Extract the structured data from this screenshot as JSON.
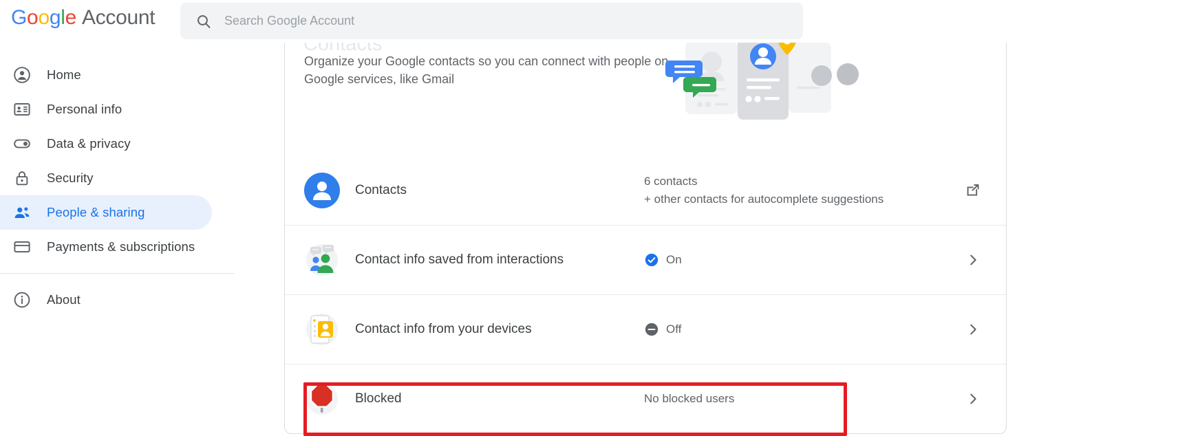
{
  "header": {
    "brand_google": [
      "G",
      "o",
      "o",
      "g",
      "l",
      "e"
    ],
    "brand_account": "Account",
    "search_placeholder": "Search Google Account",
    "search_value": "",
    "search_icon": "search-icon"
  },
  "sidebar": {
    "items": [
      {
        "label": "Home",
        "icon": "account-circle-icon",
        "active": false
      },
      {
        "label": "Personal info",
        "icon": "id-card-icon",
        "active": false
      },
      {
        "label": "Data & privacy",
        "icon": "toggle-switch-icon",
        "active": false
      },
      {
        "label": "Security",
        "icon": "lock-icon",
        "active": false
      },
      {
        "label": "People & sharing",
        "icon": "people-icon",
        "active": true
      },
      {
        "label": "Payments & subscriptions",
        "icon": "credit-card-icon",
        "active": false
      }
    ],
    "about": {
      "label": "About",
      "icon": "info-icon"
    }
  },
  "main": {
    "card_title": "Contacts",
    "card_description": "Organize your Google contacts so you can connect with people on Google services, like Gmail",
    "illustration": "contacts-illustration",
    "rows": [
      {
        "label": "Contacts",
        "icon": "blue-avatar-icon",
        "status_line_1": "6 contacts",
        "status_line_2": "+ other contacts for autocomplete suggestions",
        "action_icon": "external-link-icon"
      },
      {
        "label": "Contact info saved from interactions",
        "icon": "people-chat-icon",
        "status": "On",
        "status_icon": "check-circle-icon",
        "action_icon": "chevron-right-icon"
      },
      {
        "label": "Contact info from your devices",
        "icon": "device-contact-icon",
        "status": "Off",
        "status_icon": "minus-circle-icon",
        "action_icon": "chevron-right-icon"
      },
      {
        "label": "Blocked",
        "icon": "stop-sign-icon",
        "status": "No blocked users",
        "action_icon": "chevron-right-icon",
        "highlighted": true
      }
    ]
  },
  "colors": {
    "google_blue": "#4285F4",
    "google_red": "#EA4335",
    "google_yellow": "#FBBC05",
    "google_green": "#34A853",
    "accent_blue": "#1a73e8",
    "active_bg": "#e8f0fe",
    "highlight_red": "#e51c23",
    "text_primary": "#3c4043",
    "text_secondary": "#5f6368"
  }
}
